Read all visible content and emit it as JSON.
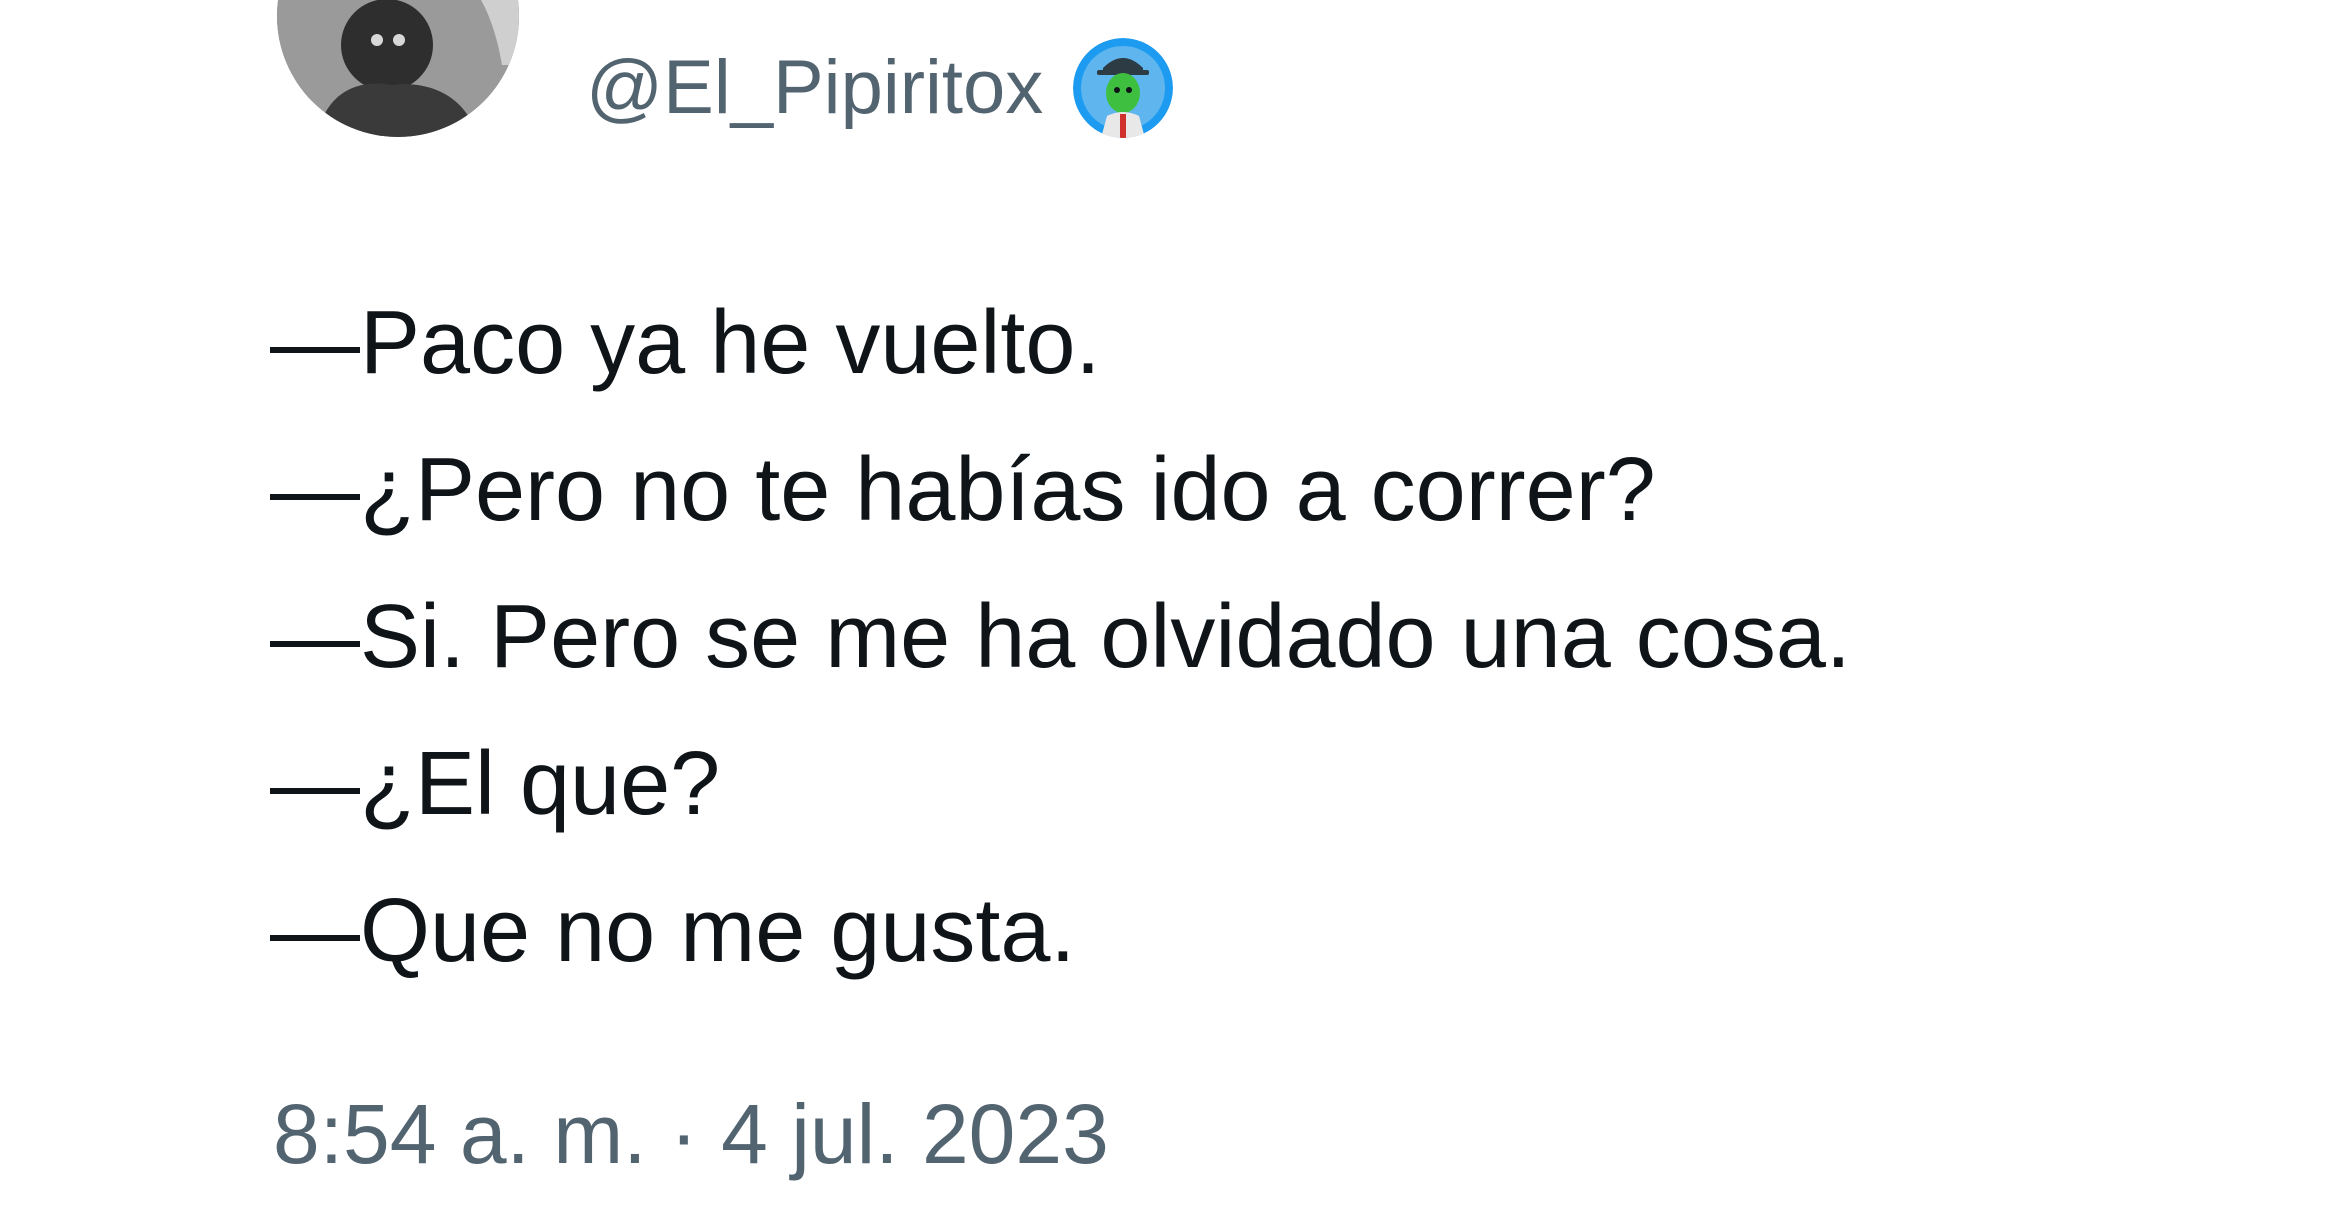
{
  "tweet": {
    "author": {
      "display_name": "",
      "handle": "@El_Pipiritox",
      "avatar_icon": "user-avatar-icon",
      "badge_icon": "profile-emoji-badge-icon"
    },
    "lines": [
      "—Paco ya he vuelto.",
      "—¿Pero no te habías ido a correr?",
      "—Si. Pero se me ha olvidado una cosa.",
      "—¿El que?",
      "—Que no me gusta."
    ],
    "timestamp": "8:54 a. m. · 4 jul. 2023"
  },
  "colors": {
    "text_primary": "#0f1419",
    "text_secondary": "#536471",
    "background": "#ffffff",
    "badge_background": "#1d9bf0",
    "badge_figure": "#3fbf3f"
  }
}
